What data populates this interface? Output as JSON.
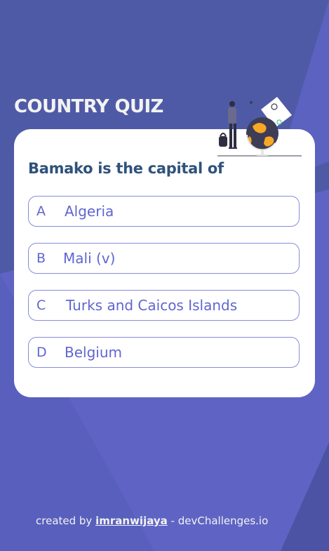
{
  "app": {
    "title": "COUNTRY QUIZ"
  },
  "quiz": {
    "question": "Bamako is the capital of",
    "options": [
      {
        "letter": "A",
        "text": "Algeria"
      },
      {
        "letter": "B",
        "text": "Mali (v)"
      },
      {
        "letter": "C",
        "text": "Turks and Caicos Islands"
      },
      {
        "letter": "D",
        "text": "Belgium"
      }
    ]
  },
  "footer": {
    "prefix": "created by",
    "author": "imranwijaya",
    "suffix": "- devChallenges.io"
  },
  "colors": {
    "background": "#4f5aa6",
    "background_accent": "#6066d0",
    "card": "#ffffff",
    "question_text": "#2f527b",
    "option_text": "#6066d0",
    "title_text": "#f2f2f2"
  },
  "icons": {
    "illustration": "traveler-with-globe-illustration"
  }
}
